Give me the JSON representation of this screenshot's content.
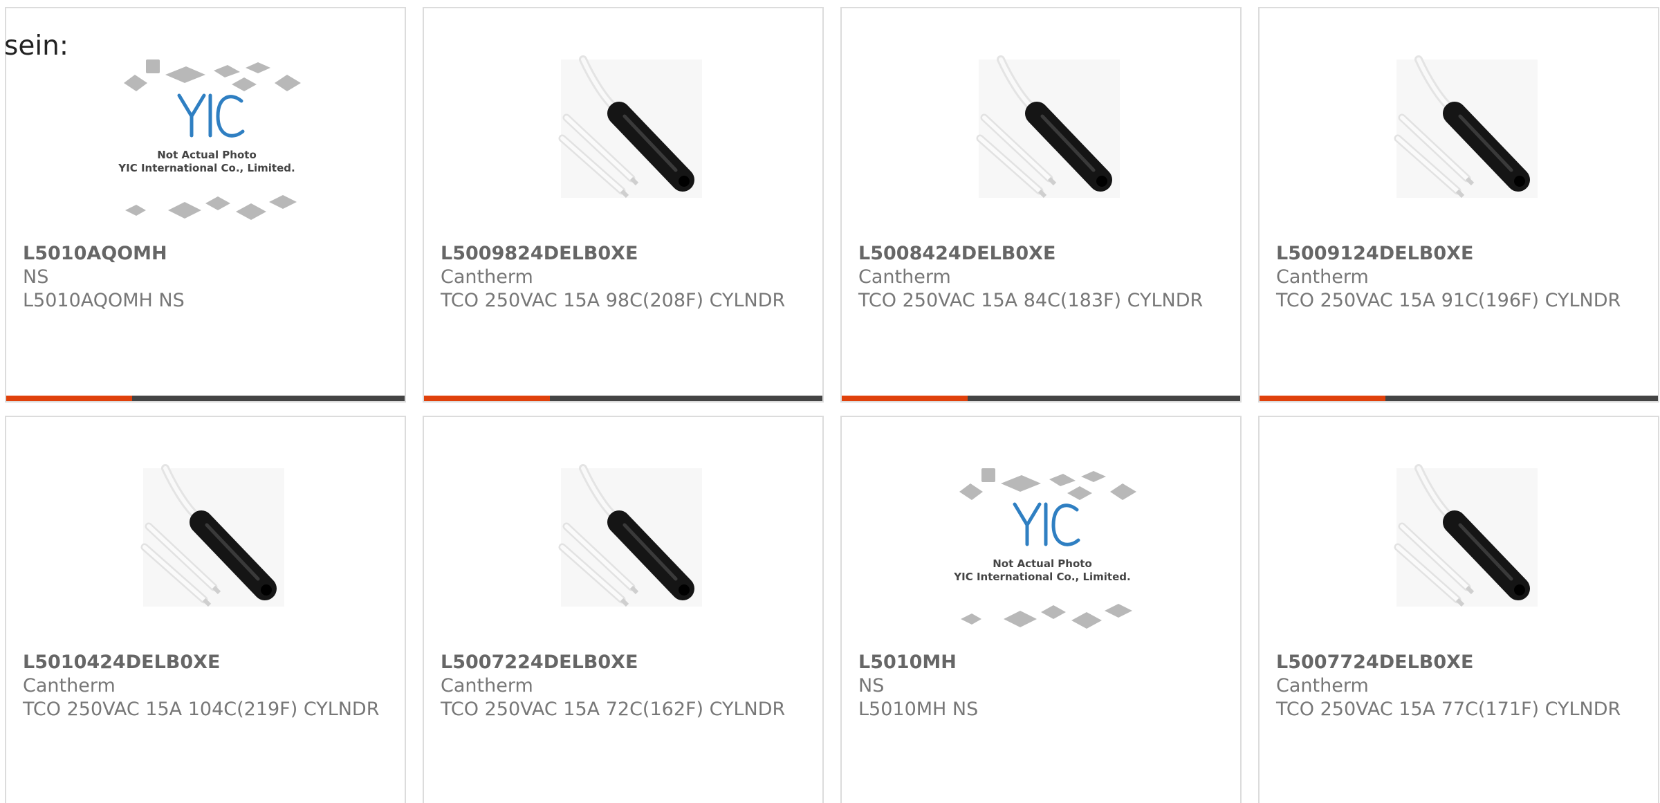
{
  "intro": {
    "text": "sein:"
  },
  "products": [
    {
      "part_number": "L5010AQOMH",
      "manufacturer": "NS",
      "description": "L5010AQOMH NS",
      "image": "placeholder-yic",
      "image_caption_1": "Not Actual Photo",
      "image_caption_2": "YIC International Co., Limited."
    },
    {
      "part_number": "L5009824DELB0XE",
      "manufacturer": "Cantherm",
      "description": "TCO 250VAC 15A 98C(208F) CYLNDR",
      "image": "thermal-cutoff"
    },
    {
      "part_number": "L5008424DELB0XE",
      "manufacturer": "Cantherm",
      "description": "TCO 250VAC 15A 84C(183F) CYLNDR",
      "image": "thermal-cutoff"
    },
    {
      "part_number": "L5009124DELB0XE",
      "manufacturer": "Cantherm",
      "description": "TCO 250VAC 15A 91C(196F) CYLNDR",
      "image": "thermal-cutoff"
    },
    {
      "part_number": "L5010424DELB0XE",
      "manufacturer": "Cantherm",
      "description": "TCO 250VAC 15A 104C(219F) CYLNDR",
      "image": "thermal-cutoff"
    },
    {
      "part_number": "L5007224DELB0XE",
      "manufacturer": "Cantherm",
      "description": "TCO 250VAC 15A 72C(162F) CYLNDR",
      "image": "thermal-cutoff"
    },
    {
      "part_number": "L5010MH",
      "manufacturer": "NS",
      "description": "L5010MH NS",
      "image": "placeholder-yic",
      "image_caption_1": "Not Actual Photo",
      "image_caption_2": "YIC International Co., Limited."
    },
    {
      "part_number": "L5007724DELB0XE",
      "manufacturer": "Cantherm",
      "description": "TCO 250VAC 15A 77C(171F) CYLNDR",
      "image": "thermal-cutoff"
    }
  ],
  "colors": {
    "accent": "#e0410b",
    "bar": "#444444",
    "border": "#dcdcdc"
  }
}
